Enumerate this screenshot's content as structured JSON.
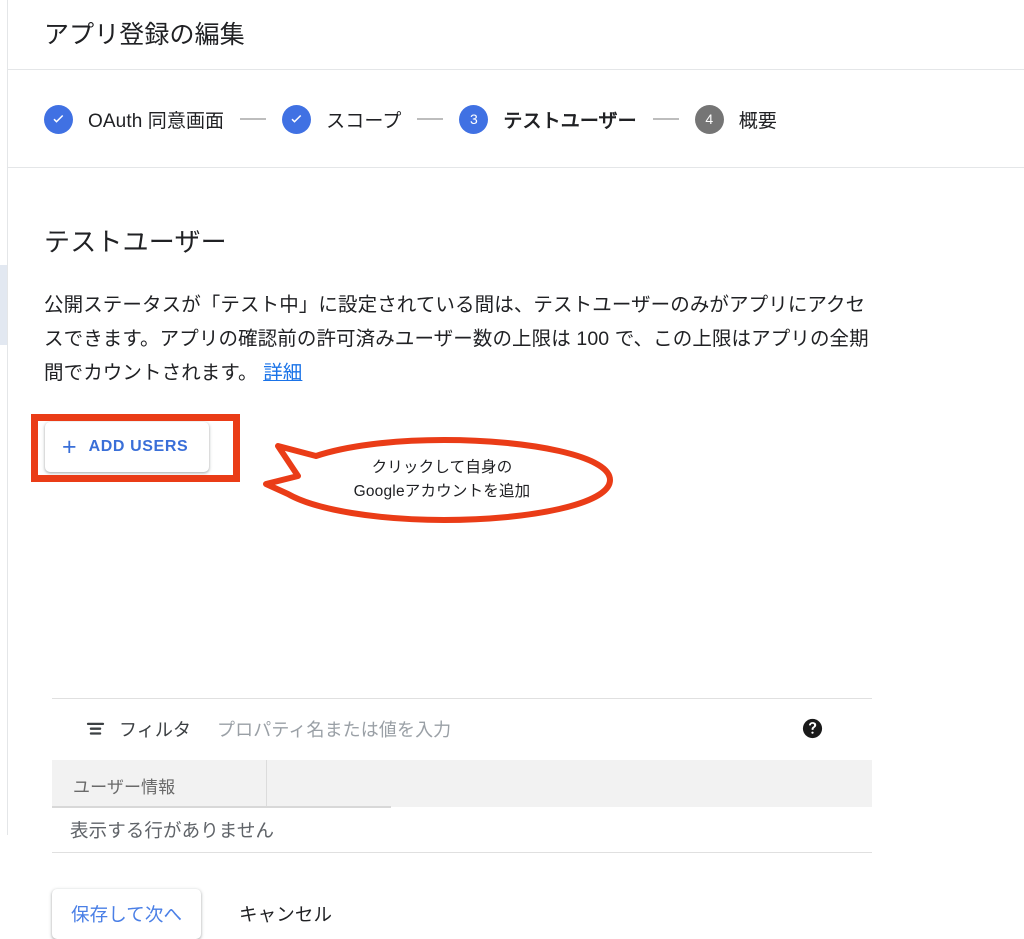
{
  "header": {
    "title": "アプリ登録の編集"
  },
  "stepper": {
    "steps": [
      {
        "label": "OAuth 同意画面",
        "state": "done",
        "marker": "check-icon"
      },
      {
        "label": "スコープ",
        "state": "done",
        "marker": "check-icon"
      },
      {
        "label": "テストユーザー",
        "state": "active",
        "marker": "3"
      },
      {
        "label": "概要",
        "state": "todo",
        "marker": "4"
      }
    ]
  },
  "main": {
    "section_title": "テストユーザー",
    "description": {
      "text": "公開ステータスが「テスト中」に設定されている間は、テストユーザーのみがアプリにアクセスできます。アプリの確認前の許可済みユーザー数の上限は 100 で、この上限はアプリの全期間でカウントされます。",
      "link_label": "詳細"
    },
    "add_users_button": {
      "icon": "plus-icon",
      "label": "ADD USERS"
    },
    "filter": {
      "icon": "filter-list-icon",
      "label": "フィルタ",
      "placeholder": "プロパティ名または値を入力",
      "help_icon": "help-circle-icon"
    },
    "table": {
      "columns": [
        "ユーザー情報",
        ""
      ],
      "empty_message": "表示する行がありません"
    },
    "actions": {
      "save_label": "保存して次へ",
      "cancel_label": "キャンセル"
    }
  },
  "annotations": {
    "highlight_color": "#ea3c17",
    "callout": {
      "line1": "クリックして自身の",
      "line2": "Googleアカウントを追加"
    }
  },
  "colors": {
    "accent_blue": "#4071e3",
    "link_blue": "#1a73e8",
    "button_blue": "#3a6fd8",
    "step_todo_gray": "#757575",
    "annotation_red": "#ea3c17"
  }
}
